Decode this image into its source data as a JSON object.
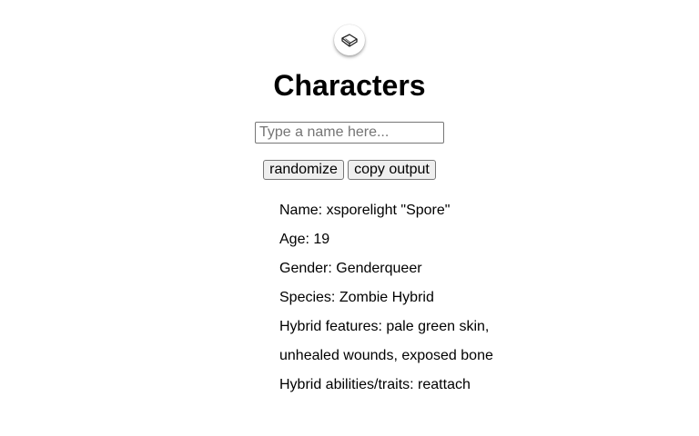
{
  "header": {
    "logo_icon": "book-icon",
    "title": "Characters"
  },
  "search": {
    "placeholder": "Type a name here...",
    "value": ""
  },
  "buttons": {
    "randomize_label": "randomize",
    "copy_label": "copy output"
  },
  "character": {
    "name": "Name: xsporelight \"Spore\"",
    "age": "Age: 19",
    "gender": "Gender: Genderqueer",
    "species": "Species: Zombie Hybrid",
    "hybrid_features": "Hybrid features: pale green skin, unhealed wounds, exposed bone",
    "hybrid_abilities": "Hybrid abilities/traits: reattach"
  }
}
